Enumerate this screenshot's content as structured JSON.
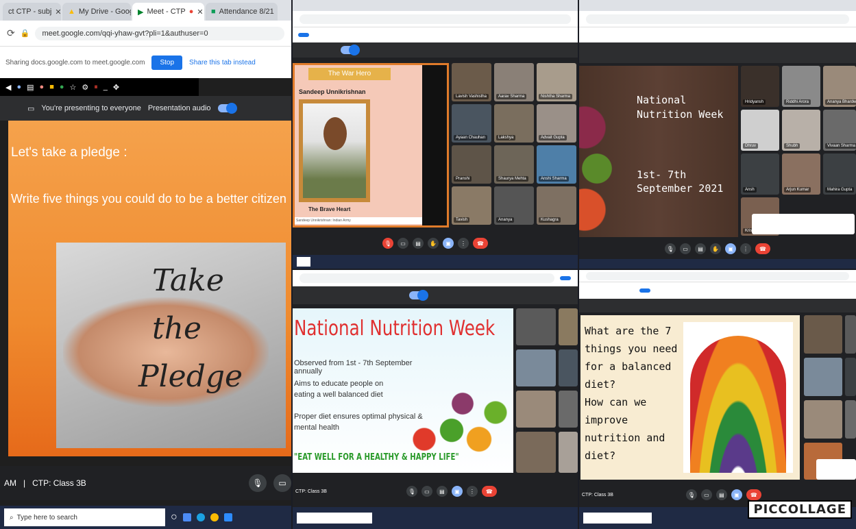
{
  "p1": {
    "tabs": [
      {
        "label": "ct CTP - subj",
        "active": false
      },
      {
        "label": "My Drive - Goog",
        "active": false
      },
      {
        "label": "Meet - CTP",
        "active": true
      },
      {
        "label": "Attendance 8/21",
        "active": false
      }
    ],
    "url": "meet.google.com/qqi-yhaw-gvt?pli=1&authuser=0",
    "share_text": "Sharing docs.google.com to meet.google.com",
    "stop_label": "Stop",
    "share_tab_label": "Share this tab instead",
    "presenting_text": "You're presenting to everyone",
    "presentation_audio": "Presentation audio",
    "slide": {
      "heading": "Let's take a pledge :",
      "body": "Write five things you could do to be a better citizen",
      "img_line1": "Take",
      "img_line2": "the",
      "img_line3": "Pledge"
    },
    "meeting_time": "AM",
    "meeting_name": "CTP: Class 3B",
    "search_placeholder": "Type here to search"
  },
  "p2": {
    "slide_name": "Sandeep Unnikrishnan",
    "slide_ribbon": "The War Hero",
    "slide_caption": "The Brave Heart",
    "slide_footer": "Sandeep Unnikrishnan: Indian Army",
    "participants": [
      "Lavish Vashistha",
      "Aarav Sharma",
      "Nishtha Sharma",
      "Ayaan Chauhan",
      "Lakshya",
      "Advait Gupta",
      "Pranshi",
      "Shaurya Mehta",
      "Anshi Sharma",
      "Tavish",
      "Ananya",
      "Kushagra"
    ]
  },
  "p3": {
    "slide_title": "National Nutrition Week",
    "slide_dates_1": "1st- 7th",
    "slide_dates_2": "September 2021",
    "participants": [
      "Hridyansh",
      "Riddhi Arora",
      "Ananya Bhardwaj",
      "Dhruv",
      "Shubh",
      "Vivaan Sharma",
      "Ansh",
      "Arjun Kumar",
      "Mahira Gupta",
      "Krishnav"
    ]
  },
  "p4": {
    "slide_title": "National Nutrition Week",
    "bullets": [
      "Observed from 1st - 7th September annually",
      "Aims to educate people on eating a well balanced diet",
      "Proper diet ensures optimal physical & mental health"
    ],
    "tagline": "\"EAT WELL FOR A HEALTHY & HAPPY LIFE\"",
    "meeting_name": "CTP: Class 3B"
  },
  "p5": {
    "slide_text": [
      "What are the 7",
      "things you need",
      "for a balanced",
      "diet?",
      "How can we",
      "improve",
      "nutrition and",
      "diet?"
    ],
    "meeting_name": "CTP: Class 3B"
  },
  "watermark": "PICCOLLAGE"
}
